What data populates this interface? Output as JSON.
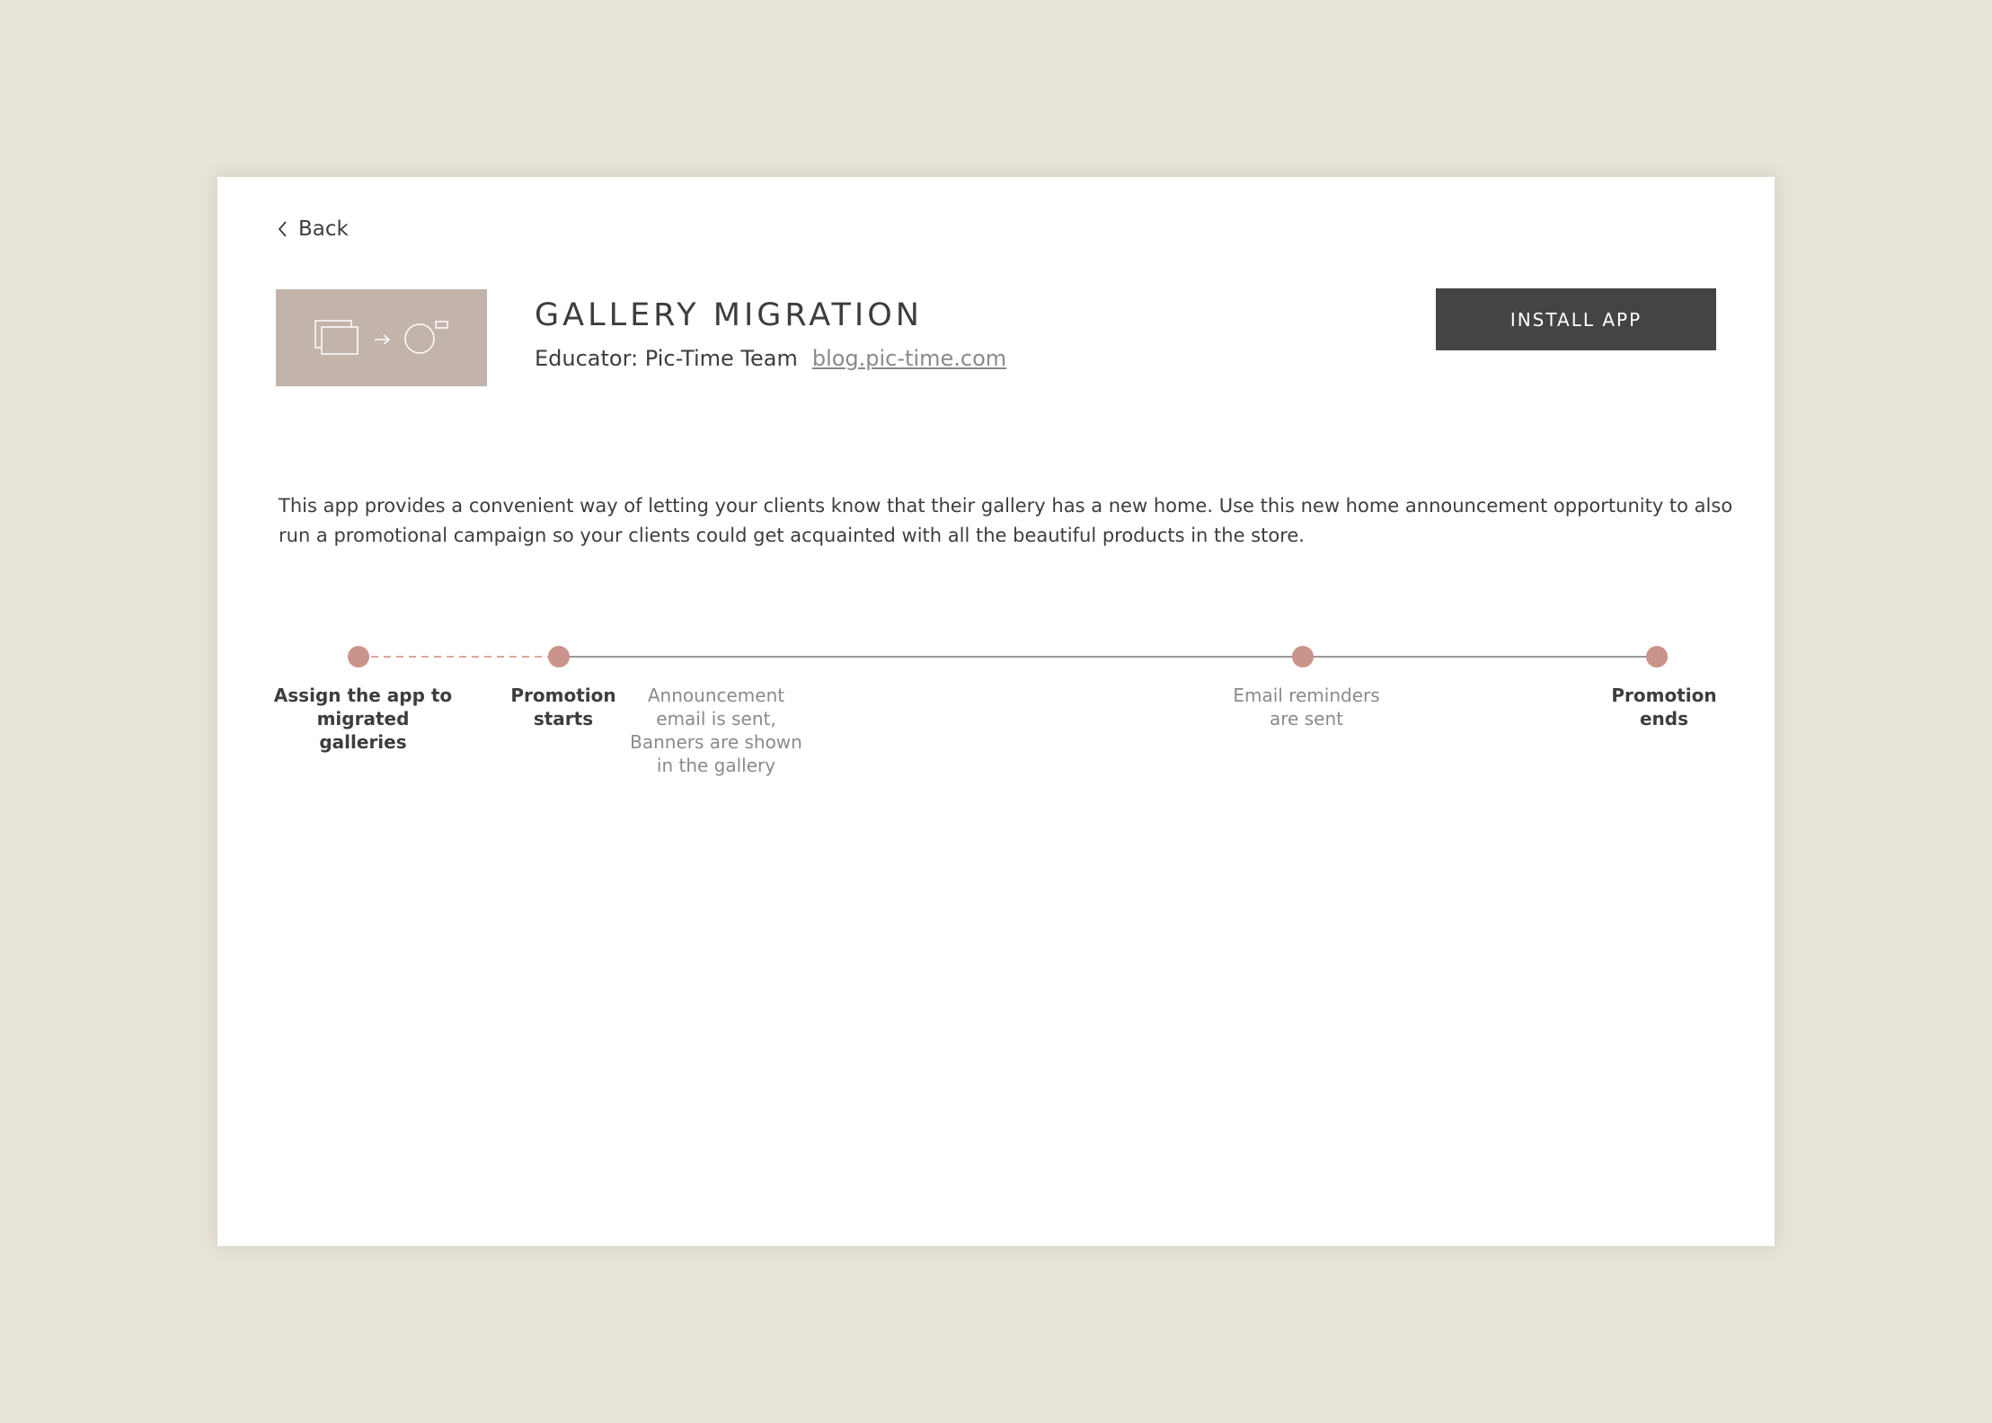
{
  "nav": {
    "back_label": "Back"
  },
  "app": {
    "title": "GALLERY MIGRATION",
    "educator_label": "Educator: Pic-Time Team",
    "educator_link": "blog.pic-time.com",
    "install_label": "INSTALL APP",
    "description": "This app provides a convenient way of letting your clients know that their gallery has a new home. Use this new home announcement opportunity to also run a promotional campaign so your clients could get acquainted with all the beautiful products in the store."
  },
  "timeline": {
    "steps": [
      {
        "label": "Assign the app to\nmigrated galleries"
      },
      {
        "label": "Promotion\nstarts"
      },
      {
        "label": "Announcement\nemail is sent,\nBanners are shown\nin the gallery"
      },
      {
        "label": "Email reminders\nare sent"
      },
      {
        "label": "Promotion\nends"
      }
    ]
  },
  "colors": {
    "page_bg": "#e6e3d9",
    "accent": "#c9948a",
    "button_bg": "#444444",
    "thumb_bg": "#c2b3ab"
  }
}
